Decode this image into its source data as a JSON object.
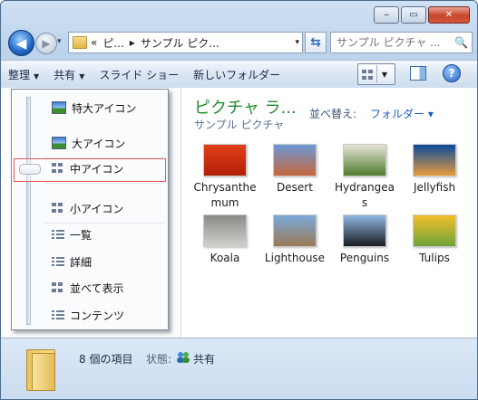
{
  "window": {
    "min_label": "‒",
    "max_label": "▭",
    "close_label": "✕"
  },
  "nav": {
    "back_glyph": "◀",
    "forward_glyph": "▶",
    "history_glyph": "▾",
    "breadcrumb": [
      "«",
      "ピ...",
      "▸",
      "サンプル ピク..."
    ],
    "address_dropdown": "▾",
    "refresh_glyph": "⇆",
    "search_placeholder": "サンプル ピクチャ ...",
    "search_glyph": "🔍"
  },
  "toolbar": {
    "organize": "整理",
    "share": "共有",
    "slideshow": "スライド ショー",
    "new_folder": "新しいフォルダー",
    "dropdown_arrow": "▼",
    "help": "?"
  },
  "library": {
    "title": "ピクチャ ラ...",
    "subtitle": "サンプル ピクチャ",
    "sort_label": "並べ替え:",
    "sort_value": "フォルダー ▾"
  },
  "items": [
    {
      "name": "Chrysanthemum",
      "line1": "Chrysanthe",
      "line2": "mum",
      "icon": "chrysanthemum-thumbnail",
      "colors": [
        "#e0401a",
        "#b32006"
      ]
    },
    {
      "name": "Desert",
      "line1": "Desert",
      "line2": "",
      "icon": "desert-thumbnail",
      "colors": [
        "#6c98d8",
        "#c5663a"
      ]
    },
    {
      "name": "Hydrangeas",
      "line1": "Hydrangea",
      "line2": "s",
      "icon": "hydrangeas-thumbnail",
      "colors": [
        "#e7e4d8",
        "#4e7c2e"
      ]
    },
    {
      "name": "Jellyfish",
      "line1": "Jellyfish",
      "line2": "",
      "icon": "jellyfish-thumbnail",
      "colors": [
        "#0b4b9c",
        "#e69b3b"
      ]
    },
    {
      "name": "Koala",
      "line1": "Koala",
      "line2": "",
      "icon": "koala-thumbnail",
      "colors": [
        "#8a8b86",
        "#cfcfcc"
      ]
    },
    {
      "name": "Lighthouse",
      "line1": "Lighthouse",
      "line2": "",
      "icon": "lighthouse-thumbnail",
      "colors": [
        "#7aa9db",
        "#9b7a55"
      ]
    },
    {
      "name": "Penguins",
      "line1": "Penguins",
      "line2": "",
      "icon": "penguins-thumbnail",
      "colors": [
        "#8fb7e1",
        "#1a1c22"
      ]
    },
    {
      "name": "Tulips",
      "line1": "Tulips",
      "line2": "",
      "icon": "tulips-thumbnail",
      "colors": [
        "#f2c02a",
        "#6fa33b"
      ]
    }
  ],
  "view_menu": {
    "selected": "中アイコン",
    "items": [
      {
        "label": "特大アイコン",
        "icon": "extra-large-icons-icon"
      },
      {
        "label": "大アイコン",
        "icon": "large-icons-icon"
      },
      {
        "label": "中アイコン",
        "icon": "medium-icons-icon"
      },
      {
        "label": "小アイコン",
        "icon": "small-icons-icon"
      },
      {
        "label": "一覧",
        "icon": "list-icon"
      },
      {
        "label": "詳細",
        "icon": "details-icon"
      },
      {
        "label": "並べて表示",
        "icon": "tiles-icon"
      },
      {
        "label": "コンテンツ",
        "icon": "content-icon"
      }
    ]
  },
  "status": {
    "count": "8 個の項目",
    "state_label": "状態:",
    "state_value": "共有"
  }
}
